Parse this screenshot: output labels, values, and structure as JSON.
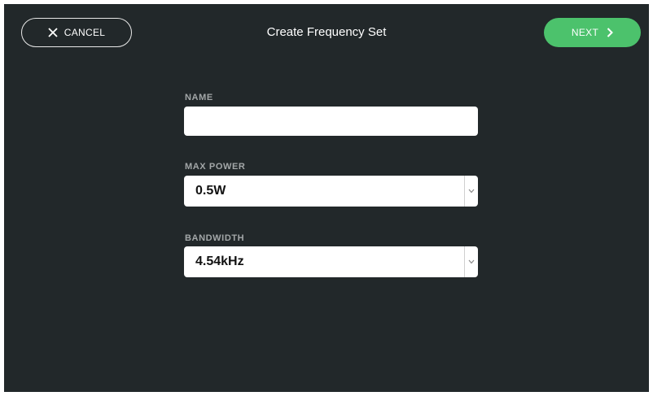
{
  "header": {
    "cancel_label": "CANCEL",
    "title": "Create Frequency Set",
    "next_label": "NEXT"
  },
  "form": {
    "name_label": "NAME",
    "name_value": "",
    "name_placeholder": "",
    "max_power_label": "MAX POWER",
    "max_power_value": "0.5W",
    "bandwidth_label": "BANDWIDTH",
    "bandwidth_value": "4.54kHz"
  },
  "icons": {
    "cancel": "close-icon",
    "next": "chevron-right-icon",
    "dropdown": "chevron-down-icon"
  },
  "colors": {
    "background": "#22282a",
    "accent_green": "#4cc26c",
    "label_gray": "#a3a7a8"
  }
}
